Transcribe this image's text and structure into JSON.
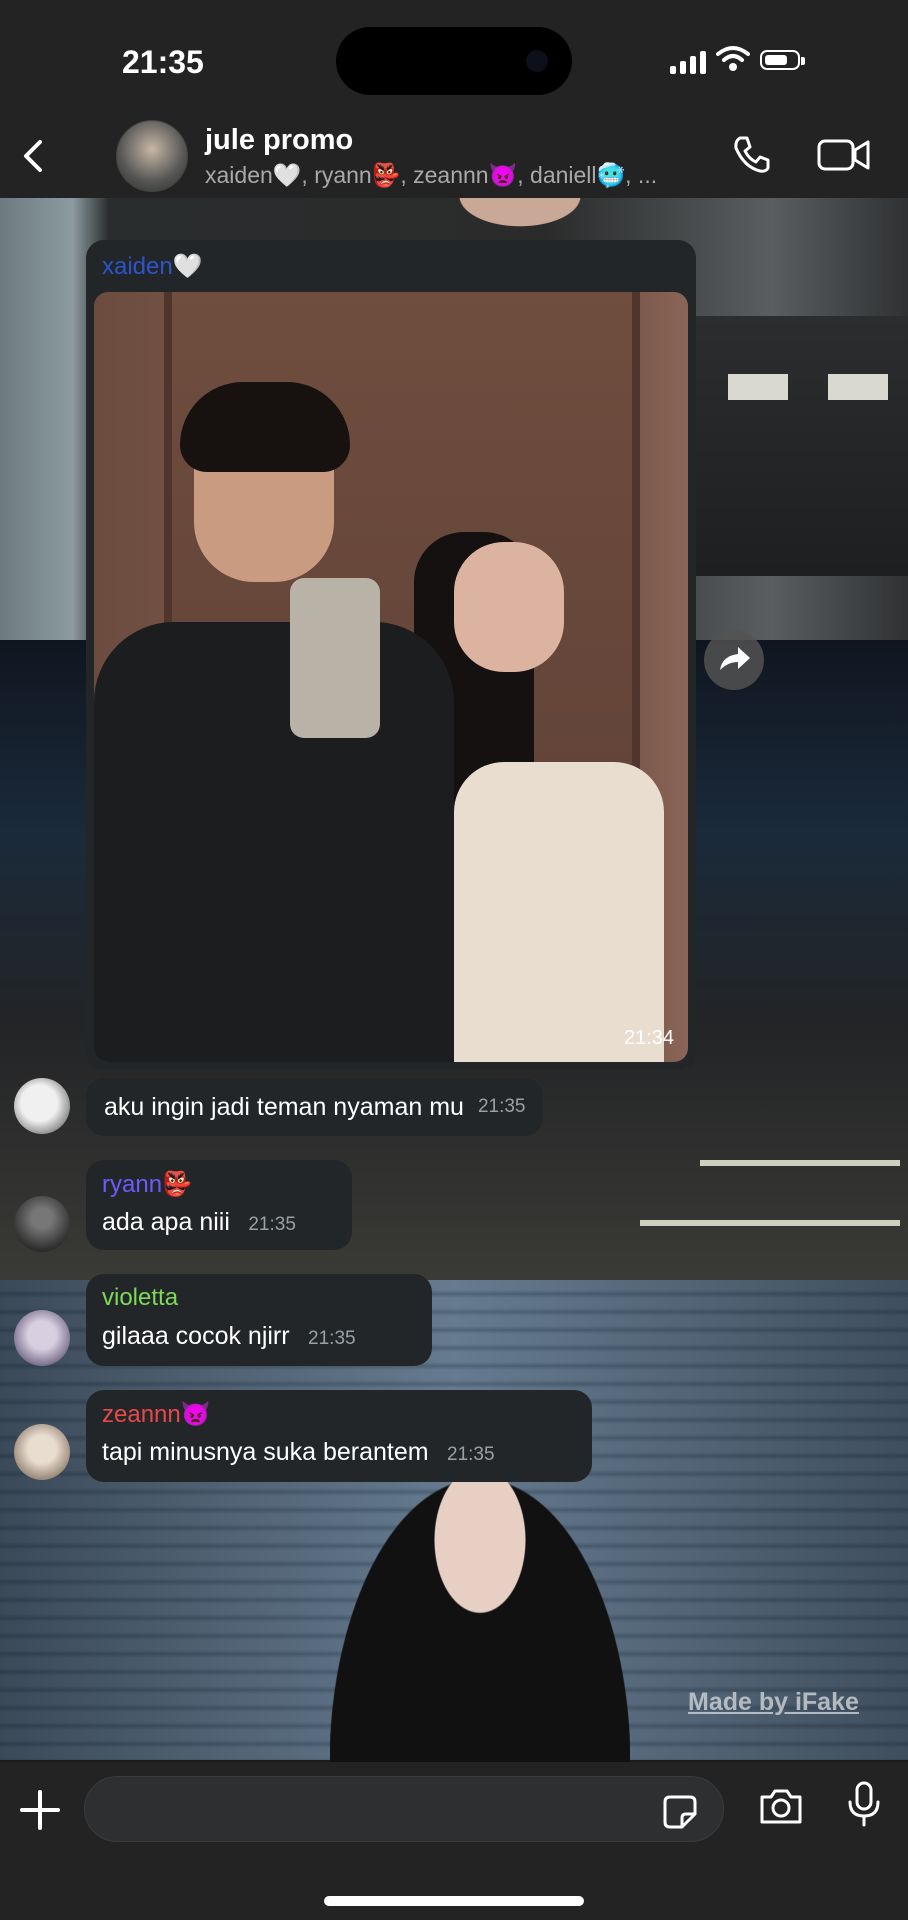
{
  "status": {
    "time": "21:35"
  },
  "header": {
    "title": "jule promo",
    "members": "xaiden🤍, ryann👺, zeannn👿, daniell🥶, ..."
  },
  "messages": [
    {
      "sender": "xaiden🤍",
      "sender_color": "#2c55c9",
      "type": "image",
      "time": "21:34"
    },
    {
      "sender": "",
      "text": "aku ingin jadi teman nyaman mu",
      "time": "21:35"
    },
    {
      "sender": "ryann👺",
      "sender_color": "#6a5cff",
      "text": "ada apa niii",
      "time": "21:35"
    },
    {
      "sender": "violetta",
      "sender_color": "#7ed957",
      "text": "gilaaa cocok njirr",
      "time": "21:35"
    },
    {
      "sender": "zeannn👿",
      "sender_color": "#e8484a",
      "text": "tapi minusnya suka berantem",
      "time": "21:35"
    }
  ],
  "watermark": "Made by iFake",
  "composer": {
    "placeholder": ""
  },
  "icons": [
    "back-icon",
    "phone-icon",
    "video-icon",
    "share-icon",
    "plus-icon",
    "sticker-icon",
    "camera-icon",
    "mic-icon"
  ]
}
